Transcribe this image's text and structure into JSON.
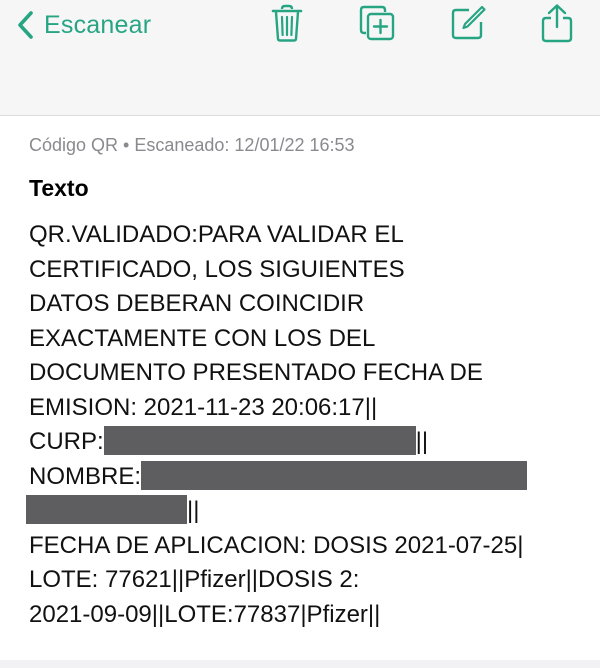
{
  "navbar": {
    "back_label": "Escanear",
    "tools": [
      {
        "icon": "trash-icon"
      },
      {
        "icon": "copy-add-icon"
      },
      {
        "icon": "edit-icon"
      },
      {
        "icon": "share-icon"
      }
    ],
    "accent_color": "#27a583"
  },
  "record": {
    "meta": "Código QR • Escaneado: 12/01/22 16:53",
    "section_title": "Texto",
    "lines": {
      "l1": "QR.VALIDADO:PARA VALIDAR EL",
      "l2": "CERTIFICADO, LOS SIGUIENTES",
      "l3": "DATOS DEBERAN COINCIDIR",
      "l4": "EXACTAMENTE CON LOS DEL",
      "l5": "DOCUMENTO PRESENTADO FECHA DE",
      "l6": "EMISION: 2021-11-23 20:06:17||",
      "curp_label": "CURP:",
      "curp_tail": "||",
      "nombre_label": "NOMBRE:",
      "nombre_tail": "||",
      "l10": "FECHA DE APLICACION: DOSIS 2021-07-25|",
      "l11": "LOTE: 77621||Pfizer||DOSIS 2:",
      "l12": "2021-09-09||LOTE:77837|Pfizer||"
    },
    "redaction_color": "#5e5d60"
  }
}
